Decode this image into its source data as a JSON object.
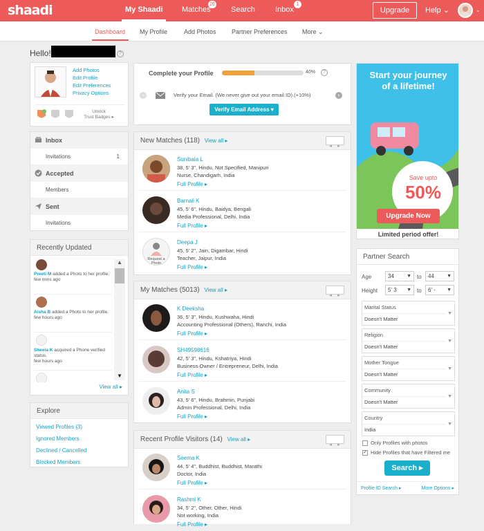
{
  "brand": {
    "logo": "shaadi",
    "accent": "#ec5a5a",
    "link": "#1a9fc0"
  },
  "topnav": {
    "my_shaadi": "My Shaadi",
    "matches": "Matches",
    "matches_badge": "26",
    "search": "Search",
    "inbox": "Inbox",
    "inbox_badge": "1",
    "upgrade": "Upgrade",
    "help": "Help"
  },
  "subnav": {
    "dashboard": "Dashboard",
    "my_profile": "My Profile",
    "add_photos": "Add Photos",
    "partner_preferences": "Partner Preferences",
    "more": "More"
  },
  "greeting": "Hello!",
  "profile_card": {
    "links": [
      "Add Photos",
      "Edit Profile",
      "Edit Preferences",
      "Privacy Options"
    ],
    "unlock": "Unlock",
    "trust_badges": "Trust Badges"
  },
  "inbox_panel": {
    "inbox": "Inbox",
    "invitations_label": "Invitations",
    "invitations_count": "1",
    "accepted": "Accepted",
    "members": "Members",
    "sent": "Sent",
    "sent_invitations": "Invitations"
  },
  "recently_updated": {
    "title": "Recently Updated",
    "items": [
      {
        "name": "Preeti M",
        "text": " added a Photo to her profile.",
        "time": "few mins ago"
      },
      {
        "name": "Aisha B",
        "text": " added a Photo to her profile.",
        "time": "few hours ago"
      },
      {
        "name": "Sheela K",
        "text": " acquired a Phone verified status.",
        "time": "few hours ago"
      }
    ],
    "view_all": "View all"
  },
  "explore": {
    "title": "Explore",
    "links": [
      "Viewed Profiles (3)",
      "Ignored Members",
      "Declined / Cancelled",
      "Blocked Members"
    ]
  },
  "complete_profile": {
    "title": "Complete your Profile",
    "progress_percent": 40,
    "progress_label": "40%",
    "verify_text": "Verify your Email. (We never give out your email ID).(+10%)",
    "verify_button": "Verify Email Address"
  },
  "new_matches": {
    "title": "New Matches (118)",
    "view_all": "View all",
    "items": [
      {
        "name": "Sunibala L",
        "line1": "38, 5' 3\", Hindu, Not Specified, Manipuri",
        "line2": "Nurse, Chandigarh, India",
        "link": "Full Profile"
      },
      {
        "name": "Barnali K",
        "line1": "45, 5' 6\", Hindu, Baidya, Bengali",
        "line2": "Media Professional, Delhi, India",
        "link": "Full Profile"
      },
      {
        "name": "Deepa J",
        "line1": "45, 5' 2\", Jain, Digambar, Hindi",
        "line2": "Teacher, Jaipur, India",
        "link": "Full Profile",
        "photo_text": "Request a Photo"
      }
    ]
  },
  "my_matches": {
    "title": "My Matches (5013)",
    "view_all": "View all",
    "items": [
      {
        "name": "K Deeksha",
        "line1": "36, 5' 3\", Hindu, Kushwaha, Hindi",
        "line2": "Accounting Professional (Others), Ranchi, India",
        "link": "Full Profile"
      },
      {
        "name": "SH49598616",
        "line1": "42, 5' 3\", Hindu, Kshatriya, Hindi",
        "line2": "Business Owner / Entrepreneur, Delhi, India",
        "link": "Full Profile"
      },
      {
        "name": "Anita S",
        "line1": "43, 5' 6\", Hindu, Brahmin, Punjabi",
        "line2": "Admin Professional, Delhi, India",
        "link": "Full Profile"
      }
    ]
  },
  "visitors": {
    "title": "Recent Profile Visitors (14)",
    "view_all": "View all",
    "items": [
      {
        "name": "Seema K",
        "line1": "44, 5' 4\", Buddhist, Buddhist, Marathi",
        "line2": "Doctor, India",
        "link": "Full Profile"
      },
      {
        "name": "Rashmi K",
        "line1": "34, 5' 2\", Other, Other, Hindi",
        "line2": "Not working, India",
        "link": "Full Profile"
      }
    ]
  },
  "ad": {
    "headline1": "Start your journey",
    "headline2": "of a lifetime!",
    "save_upto": "Save upto",
    "percent": "50%",
    "button": "Upgrade Now",
    "footer": "Limited period offer!"
  },
  "partner_search": {
    "title": "Partner Search",
    "age_label": "Age",
    "age_from": "34",
    "age_to": "44",
    "height_label": "Height",
    "height_from": "5' 3",
    "height_to": "6' -",
    "to": "to",
    "fields": [
      {
        "title": "Marital Status",
        "value": "Doesn't Matter"
      },
      {
        "title": "Religion",
        "value": "Doesn't Matter"
      },
      {
        "title": "Mother Tongue",
        "value": "Doesn't Matter"
      },
      {
        "title": "Community",
        "value": "Doesn't Matter"
      },
      {
        "title": "Country",
        "value": "India"
      }
    ],
    "only_photos": "Only Profiles with photos",
    "hide_filtered": "Hide Profiles that have Filtered me",
    "search_button": "Search",
    "profile_id_search": "Profile ID Search",
    "more_options": "More Options"
  }
}
